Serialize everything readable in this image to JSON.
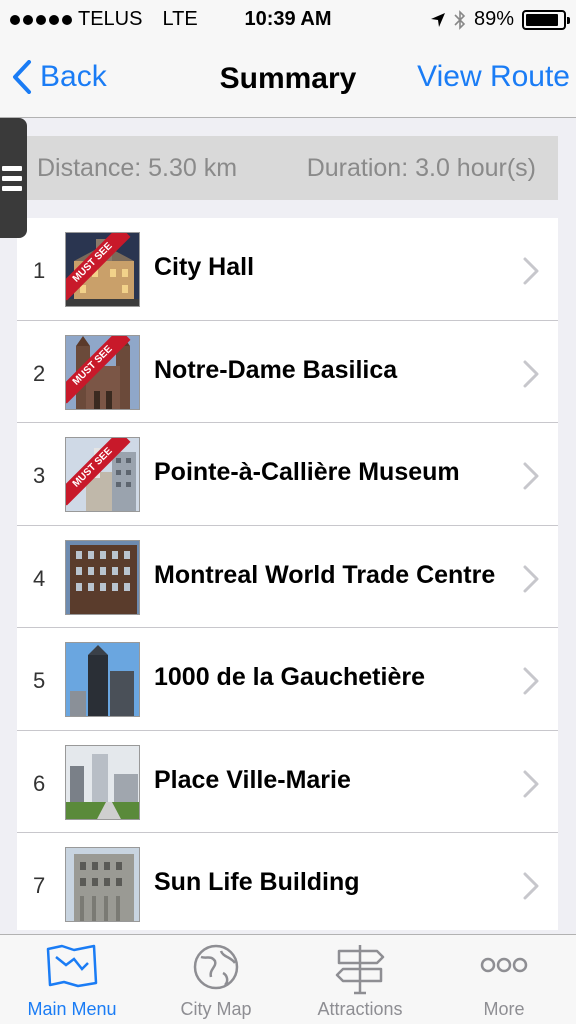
{
  "status": {
    "carrier": "TELUS",
    "network": "LTE",
    "time": "10:39 AM",
    "battery": "89%",
    "battery_level": 0.89
  },
  "nav": {
    "back": "Back",
    "title": "Summary",
    "right": "View Route"
  },
  "summary": {
    "distance": "Distance: 5.30 km",
    "duration": "Duration: 3.0 hour(s)"
  },
  "ribbon_text": "MUST SEE",
  "items": [
    {
      "num": "1",
      "name": "City Hall",
      "must_see": true
    },
    {
      "num": "2",
      "name": "Notre-Dame Basilica",
      "must_see": true
    },
    {
      "num": "3",
      "name": "Pointe-à-Callière Museum",
      "must_see": true
    },
    {
      "num": "4",
      "name": "Montreal World Trade Centre",
      "must_see": false
    },
    {
      "num": "5",
      "name": "1000 de la Gauchetière",
      "must_see": false
    },
    {
      "num": "6",
      "name": "Place Ville-Marie",
      "must_see": false
    },
    {
      "num": "7",
      "name": "Sun Life Building",
      "must_see": false
    }
  ],
  "tabs": [
    {
      "label": "Main Menu",
      "icon": "map-icon",
      "active": true
    },
    {
      "label": "City Map",
      "icon": "globe-icon",
      "active": false
    },
    {
      "label": "Attractions",
      "icon": "signpost-icon",
      "active": false
    },
    {
      "label": "More",
      "icon": "more-dots-icon",
      "active": false
    }
  ],
  "colors": {
    "accent": "#1a7cf5",
    "ribbon": "#c8192a"
  }
}
